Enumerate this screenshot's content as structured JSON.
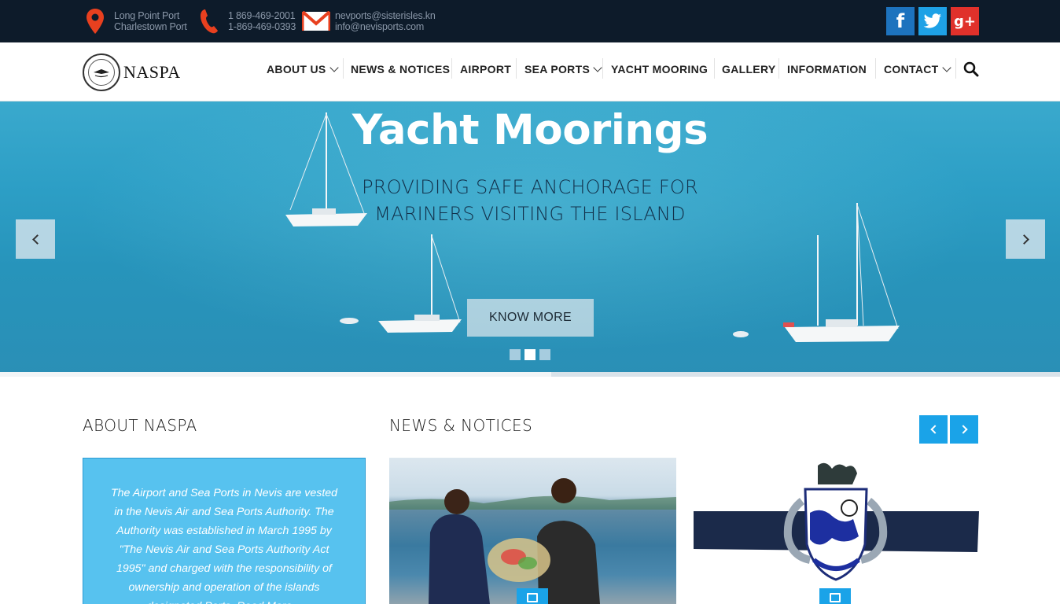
{
  "topbar": {
    "location": {
      "icon": "map-pin-icon",
      "line1": "Long Point Port",
      "line2": "Charlestown Port"
    },
    "phone": {
      "icon": "phone-icon",
      "line1": "1 869-469-2001",
      "line2": "1-869-469-0393"
    },
    "email": {
      "icon": "mail-icon",
      "line1": "nevports@sisterisles.kn",
      "line2": "info@nevisports.com"
    },
    "social": [
      {
        "name": "facebook",
        "glyph": "f",
        "color": "#1d73be"
      },
      {
        "name": "twitter",
        "glyph": "",
        "color": "#1ea1e6"
      },
      {
        "name": "google-plus",
        "glyph": "g+",
        "color": "#e0312b"
      }
    ]
  },
  "header": {
    "logo_text": "NASPA",
    "nav": [
      {
        "label": "ABOUT US",
        "dropdown": true
      },
      {
        "label": "NEWS & NOTICES",
        "dropdown": false
      },
      {
        "label": "AIRPORT",
        "dropdown": false
      },
      {
        "label": "SEA PORTS",
        "dropdown": true
      },
      {
        "label": "YACHT MOORING",
        "dropdown": false
      },
      {
        "label": "GALLERY",
        "dropdown": false
      },
      {
        "label": "INFORMATION",
        "dropdown": false
      },
      {
        "label": "CONTACT",
        "dropdown": true
      }
    ]
  },
  "hero": {
    "title": "Yacht Moorings",
    "subtitle_line1": "PROVIDING SAFE ANCHORAGE FOR",
    "subtitle_line2": "MARINERS VISITING THE ISLAND",
    "cta": "KNOW MORE",
    "slides_count": 3,
    "active_slide": 2,
    "progress": 0.52
  },
  "about": {
    "title": "ABOUT NASPA",
    "text": "The Airport and Sea Ports in Nevis are vested in the Nevis Air and Sea Ports Authority. The Authority was established in March 1995 by \"The Nevis Air and Sea Ports Authority Act 1995\" and charged with the responsibility of ownership and operation of the islands designated Ports. Read More..."
  },
  "news": {
    "title": "NEWS & NOTICES"
  },
  "colors": {
    "topbar_bg": "#0d1b2a",
    "accent": "#1aa3e8",
    "about_bg": "#57c2ef"
  }
}
